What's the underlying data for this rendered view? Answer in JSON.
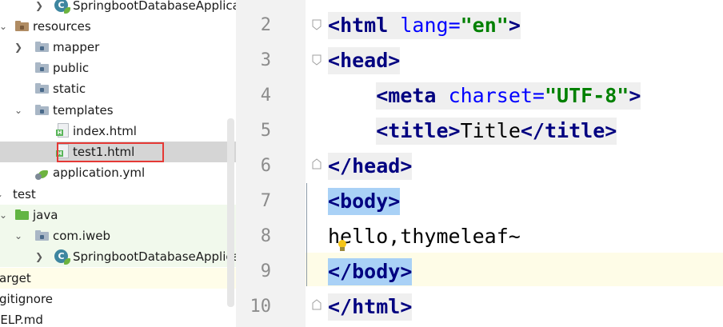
{
  "tree": {
    "items": [
      {
        "label": "SpringbootDatabaseApplica",
        "icon": "spring-class-icon"
      },
      {
        "label": "resources",
        "icon": "resources-folder-icon"
      },
      {
        "label": "mapper",
        "icon": "folder-icon"
      },
      {
        "label": "public",
        "icon": "folder-icon"
      },
      {
        "label": "static",
        "icon": "folder-icon"
      },
      {
        "label": "templates",
        "icon": "folder-icon"
      },
      {
        "label": "index.html",
        "icon": "html-file-icon"
      },
      {
        "label": "test1.html",
        "icon": "html-file-icon"
      },
      {
        "label": "application.yml",
        "icon": "spring-yml-icon"
      },
      {
        "label": "test",
        "icon": "folder-icon"
      },
      {
        "label": "java",
        "icon": "test-source-folder-icon"
      },
      {
        "label": "com.iweb",
        "icon": "package-icon"
      },
      {
        "label": "SpringbootDatabaseApplica",
        "icon": "spring-class-icon"
      },
      {
        "label": "arget",
        "icon": "none"
      },
      {
        "label": "gitignore",
        "icon": "none"
      },
      {
        "label": "IELP.md",
        "icon": "none"
      }
    ],
    "selected": "test1.html",
    "file_badge": "H"
  },
  "editor": {
    "line_numbers": [
      "2",
      "3",
      "4",
      "5",
      "6",
      "7",
      "8",
      "9",
      "10"
    ],
    "lines": {
      "l2": {
        "open": "<",
        "tag": "html",
        "sp": " ",
        "attr": "lang",
        "eq": "=",
        "val": "\"en\"",
        "close": ">"
      },
      "l3": {
        "open": "<",
        "tag": "head",
        "close": ">"
      },
      "l4": {
        "indent": "    ",
        "open": "<",
        "tag": "meta",
        "sp": " ",
        "attr": "charset",
        "eq": "=",
        "val": "\"UTF-8\"",
        "close": ">"
      },
      "l5": {
        "indent": "    ",
        "open": "<",
        "tag": "title",
        "close": ">",
        "text": "Title",
        "open2": "</",
        "tag2": "title",
        "close2": ">"
      },
      "l6": {
        "open": "</",
        "tag": "head",
        "close": ">"
      },
      "l7": {
        "open": "<",
        "tag": "body",
        "close": ">"
      },
      "l8": {
        "text": "hello,thymeleaf~"
      },
      "l9": {
        "open": "</",
        "tag": "body",
        "close": ">"
      },
      "l10": {
        "open": "</",
        "tag": "html",
        "close": ">"
      }
    },
    "colors": {
      "tag": "#000080",
      "attribute": "#0000ff",
      "string": "#008000",
      "matched_tag_highlight": "#a9d1f6",
      "current_line": "#fefce7"
    }
  }
}
